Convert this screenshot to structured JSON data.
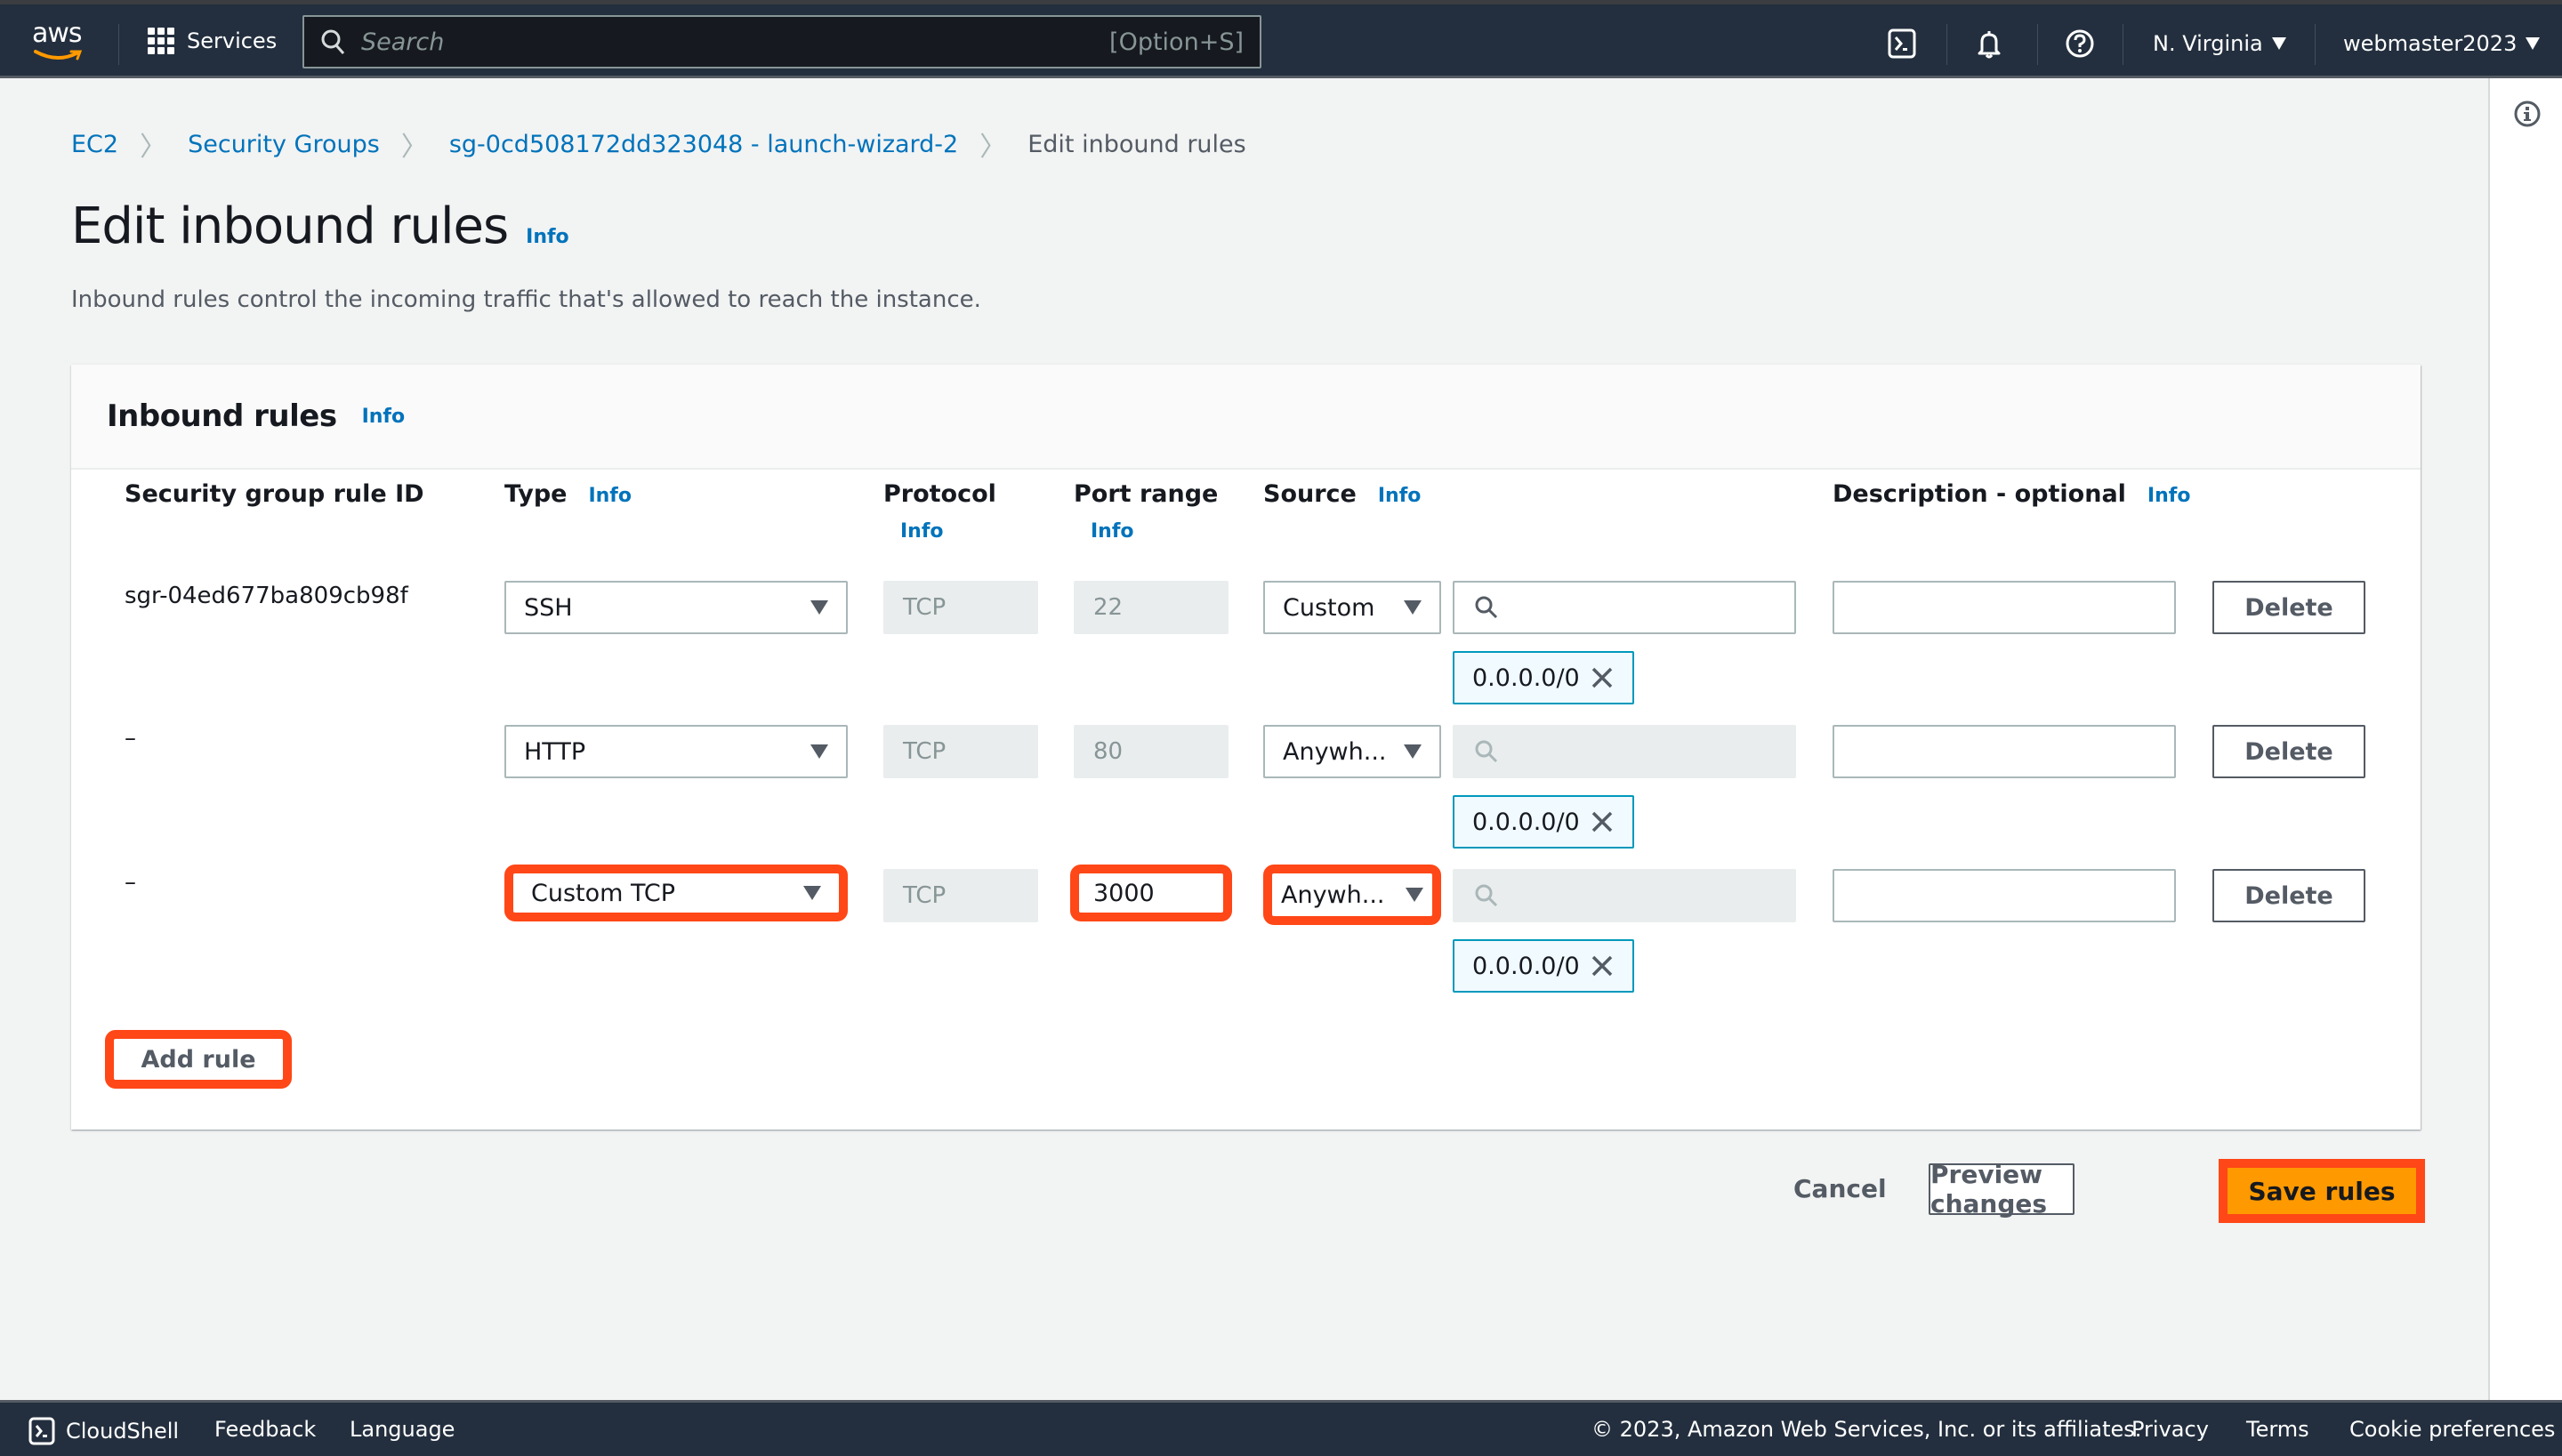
{
  "topnav": {
    "logo": "aws",
    "services_label": "Services",
    "search_placeholder": "Search",
    "search_shortcut": "[Option+S]",
    "region": "N. Virginia",
    "account": "webmaster2023"
  },
  "breadcrumb": {
    "items": [
      "EC2",
      "Security Groups",
      "sg-0cd508172dd323048 - launch-wizard-2"
    ],
    "current": "Edit inbound rules"
  },
  "page": {
    "title": "Edit inbound rules",
    "info": "Info",
    "description": "Inbound rules control the incoming traffic that's allowed to reach the instance."
  },
  "panel": {
    "title": "Inbound rules",
    "info": "Info",
    "columns": {
      "rule_id": "Security group rule ID",
      "type": "Type",
      "protocol": "Protocol",
      "port_range": "Port range",
      "source": "Source",
      "description": "Description - optional",
      "info": "Info"
    },
    "rows": [
      {
        "rule_id": "sgr-04ed677ba809cb98f",
        "type": "SSH",
        "protocol": "TCP",
        "port": "22",
        "source_type": "Custom",
        "source_search": "",
        "cidr": "0.0.0.0/0",
        "description": "",
        "delete_label": "Delete"
      },
      {
        "rule_id": "–",
        "type": "HTTP",
        "protocol": "TCP",
        "port": "80",
        "source_type": "Anywh...",
        "source_search": "",
        "cidr": "0.0.0.0/0",
        "description": "",
        "delete_label": "Delete"
      },
      {
        "rule_id": "–",
        "type": "Custom TCP",
        "protocol": "TCP",
        "port": "3000",
        "source_type": "Anywh...",
        "source_search": "",
        "cidr": "0.0.0.0/0",
        "description": "",
        "delete_label": "Delete"
      }
    ],
    "add_rule_label": "Add rule"
  },
  "actions": {
    "cancel": "Cancel",
    "preview": "Preview changes",
    "save": "Save rules"
  },
  "footer": {
    "cloudshell": "CloudShell",
    "feedback": "Feedback",
    "language": "Language",
    "copyright": "© 2023, Amazon Web Services, Inc. or its affiliates.",
    "privacy": "Privacy",
    "terms": "Terms",
    "cookies": "Cookie preferences"
  },
  "colors": {
    "nav_bg": "#232f3e",
    "link": "#0073bb",
    "primary": "#ff9900",
    "highlight": "#ff4717",
    "token_border": "#0099bc"
  }
}
